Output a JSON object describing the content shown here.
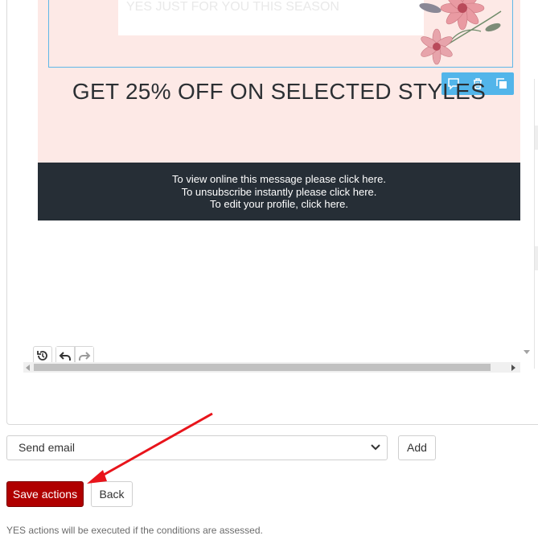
{
  "editor": {
    "headline": "GET 25% OFF ON SELECTED STYLES",
    "image_faint_text": "YES  JUST FOR YOU THIS SEASON",
    "footer_lines": [
      "To view online this message please click here.",
      "To unsubscribe instantly please click here.",
      "To edit your profile, click here."
    ],
    "block_toolbar_icons": [
      "comment-icon",
      "trash-icon",
      "duplicate-icon"
    ],
    "history_icons": [
      "history-icon",
      "undo-icon",
      "redo-icon"
    ],
    "colors": {
      "pink_background": "#fde9e6",
      "footer_background": "#262e36",
      "selection_border": "#5fb8e8",
      "toolbar": "#52b5ea"
    }
  },
  "actions": {
    "select_value": "Send email",
    "add_label": "Add",
    "save_label": "Save actions",
    "back_label": "Back",
    "note": "YES actions will be executed if the conditions are assessed.",
    "save_color": "#b00000",
    "annotation_arrow_color": "#e8141b"
  }
}
